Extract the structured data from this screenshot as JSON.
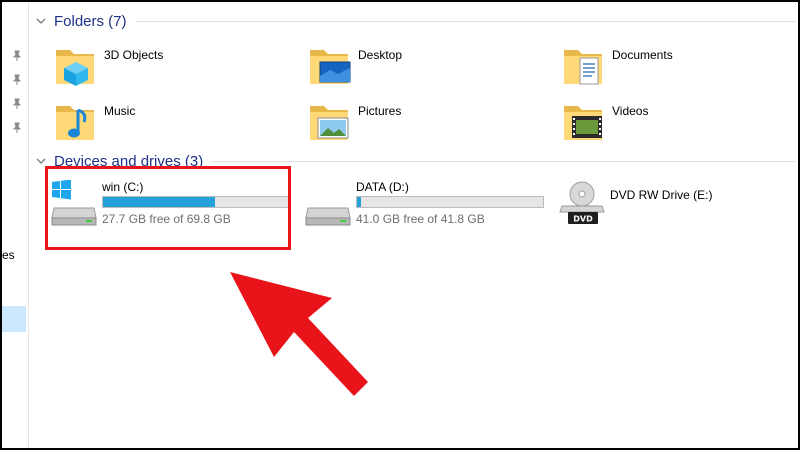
{
  "folders": {
    "header": "Folders (7)",
    "items": [
      {
        "label": "3D Objects",
        "icon": "3d-objects-folder-icon"
      },
      {
        "label": "Desktop",
        "icon": "desktop-folder-icon"
      },
      {
        "label": "Documents",
        "icon": "documents-folder-icon"
      },
      {
        "label": "Music",
        "icon": "music-folder-icon"
      },
      {
        "label": "Pictures",
        "icon": "pictures-folder-icon"
      },
      {
        "label": "Videos",
        "icon": "videos-folder-icon"
      }
    ]
  },
  "devices": {
    "header": "Devices and drives (3)",
    "drives": [
      {
        "name": "win (C:)",
        "free_text": "27.7 GB free of 69.8 GB",
        "used_fraction": 0.603,
        "icon": "windows-drive-icon"
      },
      {
        "name": "DATA (D:)",
        "free_text": "41.0 GB free of 41.8 GB",
        "used_fraction": 0.019,
        "icon": "hard-drive-icon"
      },
      {
        "name": "DVD RW Drive (E:)",
        "icon": "dvd-drive-icon"
      }
    ]
  },
  "sidebar": {
    "partial_text": "es"
  },
  "colors": {
    "accent": "#26a0da",
    "header_text": "#1e3287",
    "highlight": "#e8141a"
  }
}
